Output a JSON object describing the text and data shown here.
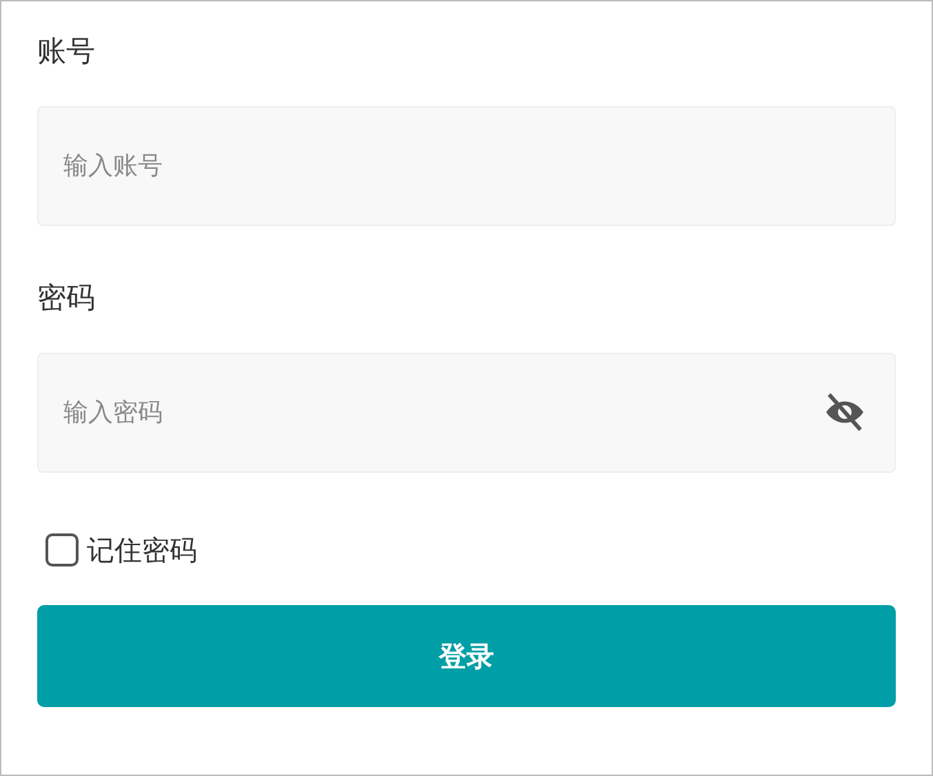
{
  "fields": [
    {
      "label": "账号",
      "placeholder": "输入账号",
      "kind": "text"
    },
    {
      "label": "密码",
      "placeholder": "输入密码",
      "kind": "password"
    }
  ],
  "remember": {
    "label": "记住密码",
    "checked": false
  },
  "login_button": "登录"
}
